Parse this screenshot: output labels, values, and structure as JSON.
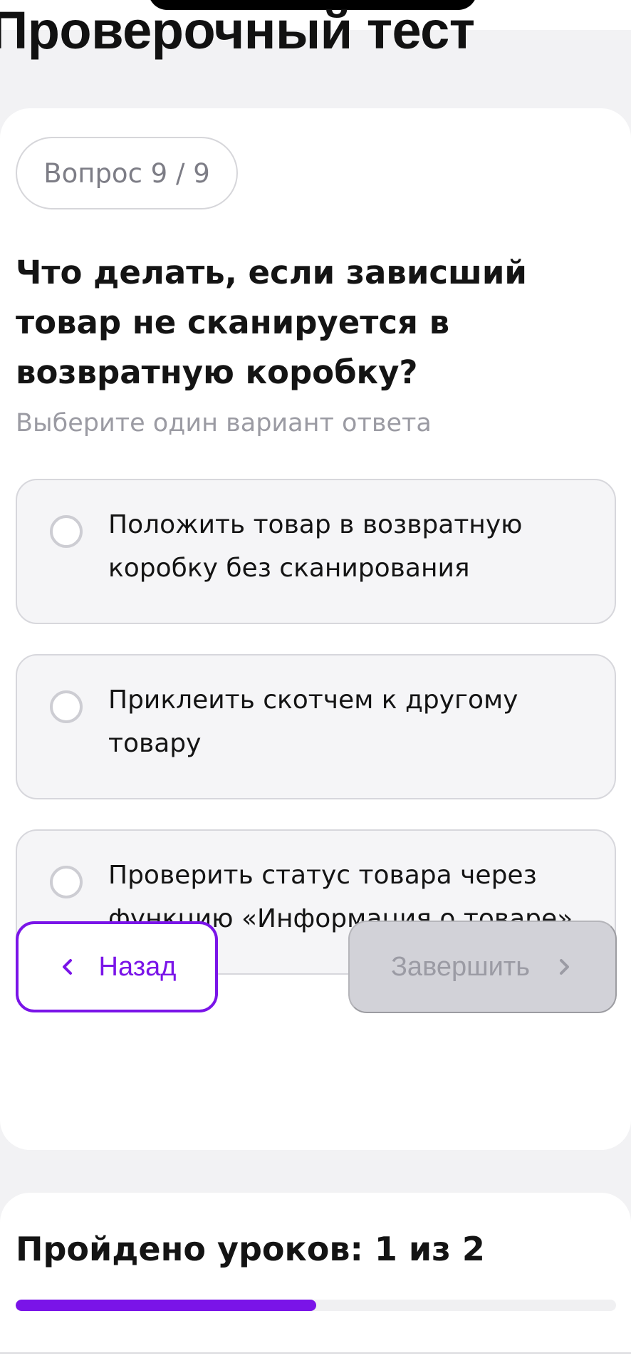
{
  "header": {
    "title": "Проверочный тест"
  },
  "quiz": {
    "counter": "Вопрос 9 / 9",
    "question": "Что делать, если зависший товар не сканируется в возвратную коробку?",
    "hint": "Выберите один вариант ответа",
    "options": [
      {
        "label": "Положить товар в возвратную коробку без сканирования",
        "selected": false
      },
      {
        "label": "Приклеить скотчем к другому товару",
        "selected": false
      },
      {
        "label": "Проверить статус товара через функцию «Информация о товаре»",
        "selected": false
      }
    ],
    "back_label": "Назад",
    "back_icon": "chevron-left-icon",
    "finish_label": "Завершить",
    "finish_icon": "chevron-right-icon",
    "finish_disabled": true
  },
  "progress": {
    "title": "Пройдено уроков: 1 из 2",
    "completed": 1,
    "total": 2
  },
  "colors": {
    "accent": "#7a14e8",
    "disabled_button": "#d2d2d8",
    "card_background": "#ffffff",
    "page_background": "#f2f2f4"
  }
}
